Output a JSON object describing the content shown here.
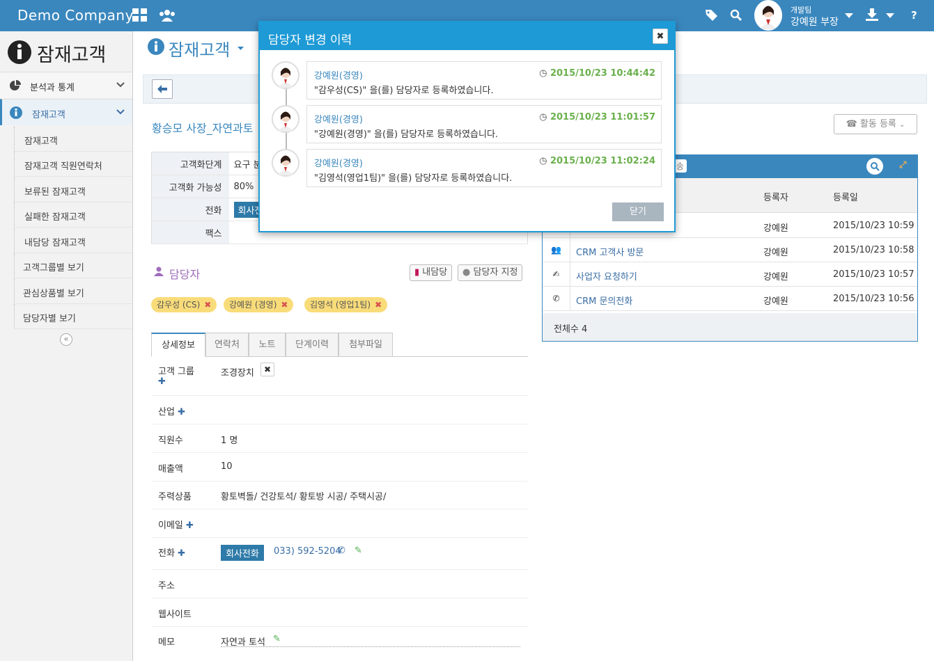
{
  "topbar": {
    "brand": "Demo Company",
    "user_team": "개발팀",
    "user_name": "강예원 부장"
  },
  "sidebar": {
    "title": "잠재고객",
    "sections": [
      {
        "label": "분석과 통계"
      },
      {
        "label": "잠재고객"
      }
    ],
    "items": [
      {
        "label": "잠재고객"
      },
      {
        "label": "잠재고객 직원연락처"
      },
      {
        "label": "보류된 잠재고객"
      },
      {
        "label": "실패한 잠재고객"
      },
      {
        "label": "내담당 잠재고객"
      },
      {
        "label": "고객그룹별 보기"
      },
      {
        "label": "관심상품별 보기"
      },
      {
        "label": "담당자별 보기"
      }
    ]
  },
  "main": {
    "title": "잠재고객",
    "customer_title": "황승모 사장_자연과토",
    "info": [
      {
        "k": "고객화단계",
        "v": "요구 분"
      },
      {
        "k": "고객화 가능성",
        "v": "80%"
      },
      {
        "k": "전화",
        "v": "회사전"
      },
      {
        "k": "팩스",
        "v": ""
      }
    ],
    "manager_title": "담당자",
    "btn_mine": "내담당",
    "btn_assign": "담당자 지정",
    "tags": [
      {
        "label": "감우성 (CS)"
      },
      {
        "label": "강예원 (경영)"
      },
      {
        "label": "김영석 (영업1팀)"
      }
    ],
    "tabs": [
      {
        "label": "상세정보"
      },
      {
        "label": "연락처"
      },
      {
        "label": "노트"
      },
      {
        "label": "단계이력"
      },
      {
        "label": "첨부파일"
      }
    ],
    "details": [
      {
        "k": "고객 그룹",
        "v": "조경장치"
      },
      {
        "k": "산업",
        "v": ""
      },
      {
        "k": "직원수",
        "v": "1 명"
      },
      {
        "k": "매출액",
        "v": "10"
      },
      {
        "k": "주력상품",
        "v": "황토벽돌/ 건강토석/ 황토방 시공/ 주택시공/"
      },
      {
        "k": "이메일",
        "v": ""
      },
      {
        "k": "전화",
        "v": "033) 592-5204"
      },
      {
        "k": "주소",
        "v": ""
      },
      {
        "k": "웹사이트",
        "v": ""
      },
      {
        "k": "메모",
        "v": "자연과 토석"
      }
    ],
    "phone_tag": "회사전화"
  },
  "activity": {
    "btn": "활동 등록",
    "head_tail": "송",
    "col_registrant": "등록자",
    "col_date": "등록일",
    "rows": [
      {
        "title": "",
        "who": "강예원",
        "date": "2015/10/23 10:59"
      },
      {
        "title": "CRM 고객사 방문",
        "who": "강예원",
        "date": "2015/10/23 10:58"
      },
      {
        "title": "사업자 요청하기",
        "who": "강예원",
        "date": "2015/10/23 10:57"
      },
      {
        "title": "CRM 문의전화",
        "who": "강예원",
        "date": "2015/10/23 10:56"
      }
    ],
    "total": "전체수 4"
  },
  "modal": {
    "title": "담당자 변경 이력",
    "close_label": "닫기",
    "entries": [
      {
        "who": "강예원(경영)",
        "time": "2015/10/23 10:44:42",
        "msg": "\"감우성(CS)\" 을(를) 담당자로 등록하였습니다."
      },
      {
        "who": "강예원(경영)",
        "time": "2015/10/23 11:01:57",
        "msg": "\"강예원(경영)\" 을(를) 담당자로 등록하였습니다."
      },
      {
        "who": "강예원(경영)",
        "time": "2015/10/23 11:02:24",
        "msg": "\"김영석(영업1팀)\" 을(를) 담당자로 등록하였습니다."
      }
    ]
  }
}
